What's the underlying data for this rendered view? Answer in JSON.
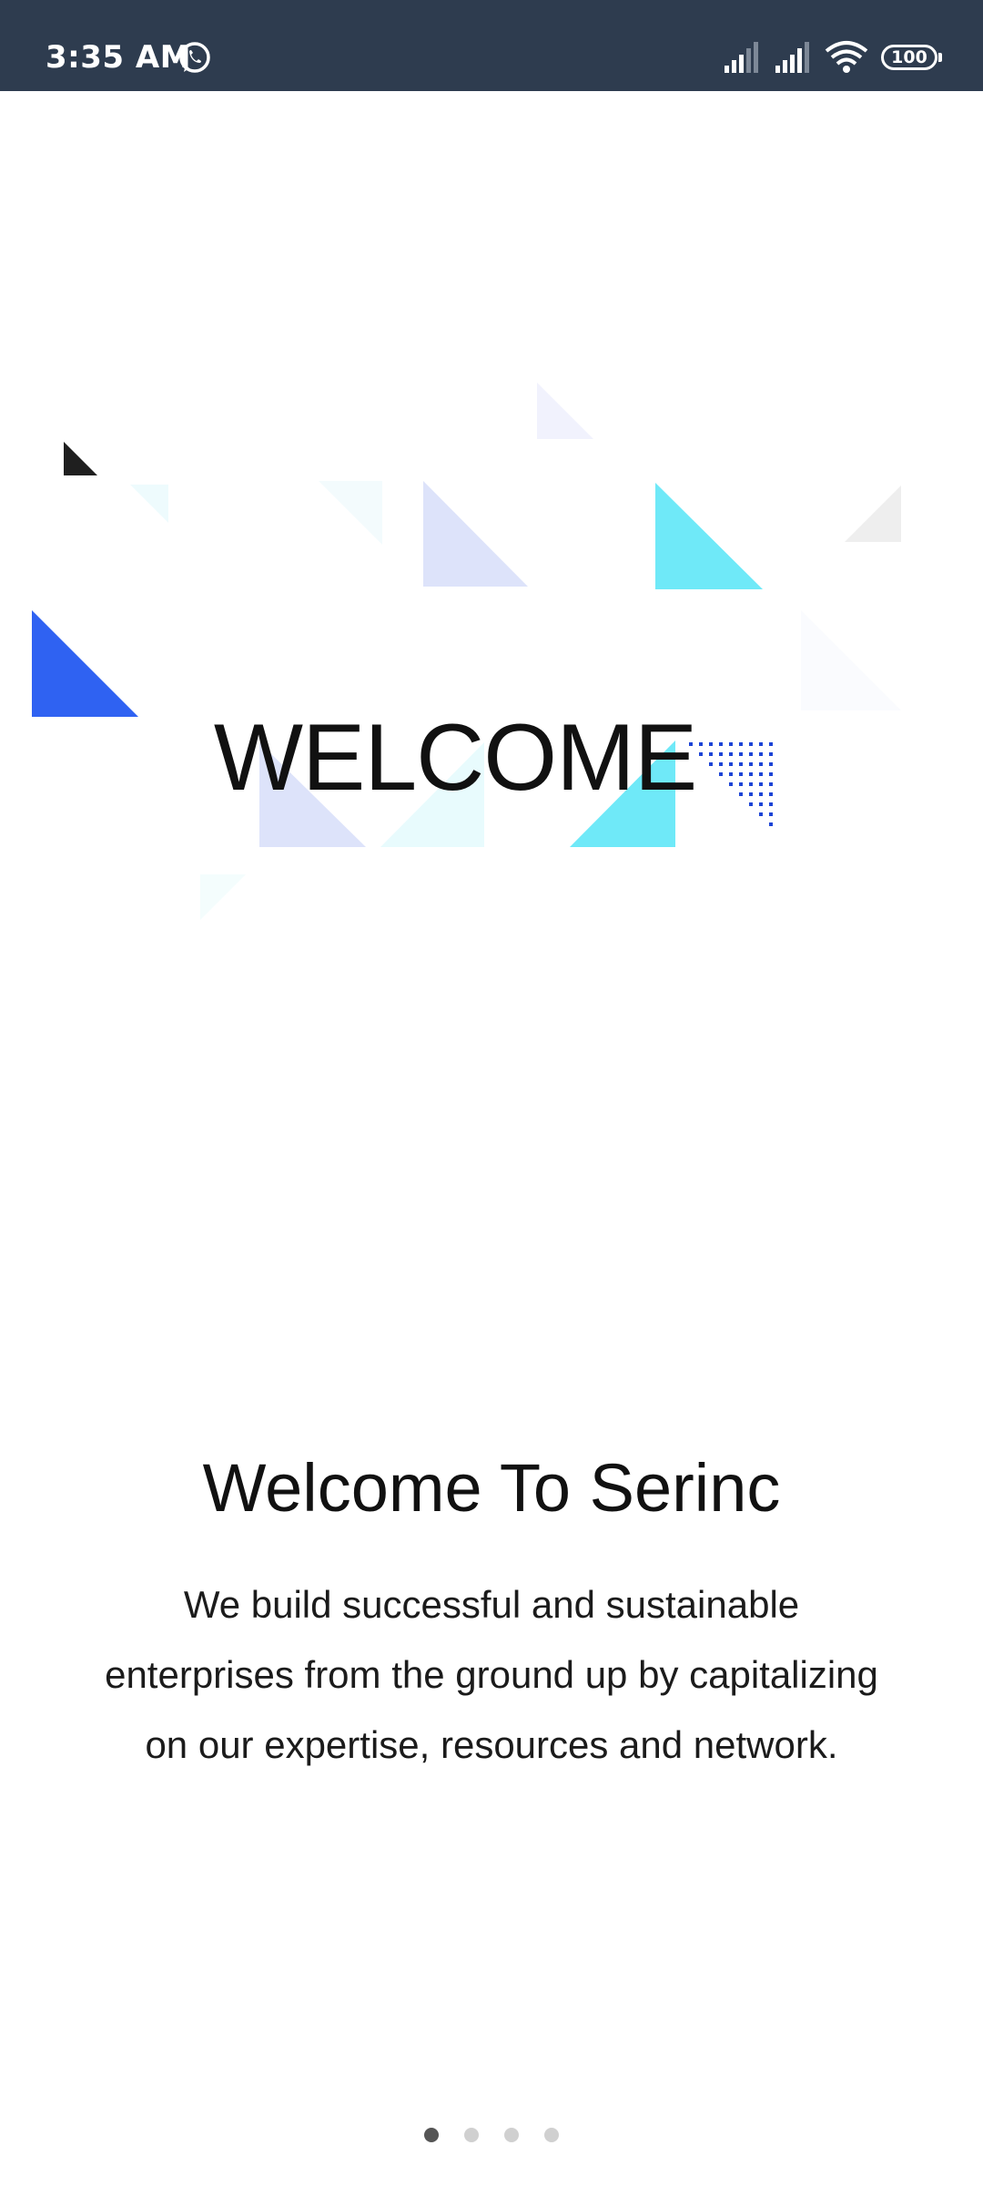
{
  "status_bar": {
    "time": "3:35 AM",
    "battery_level": "100",
    "icons": [
      "whatsapp-icon",
      "cell-signal-icon",
      "cell-signal-icon",
      "wifi-icon",
      "battery-icon"
    ]
  },
  "hero": {
    "title": "WELCOME",
    "colors": {
      "blue": "#2f62f2",
      "cyan": "#6fe9f8",
      "lavender": "#dde3fa",
      "dots": "#1c44d6"
    }
  },
  "intro": {
    "title": "Welcome To Serinc",
    "description": "We build successful and sustainable enterprises from the ground up by capitalizing on our expertise, resources and network."
  },
  "pagination": {
    "total": 4,
    "active": 1
  }
}
